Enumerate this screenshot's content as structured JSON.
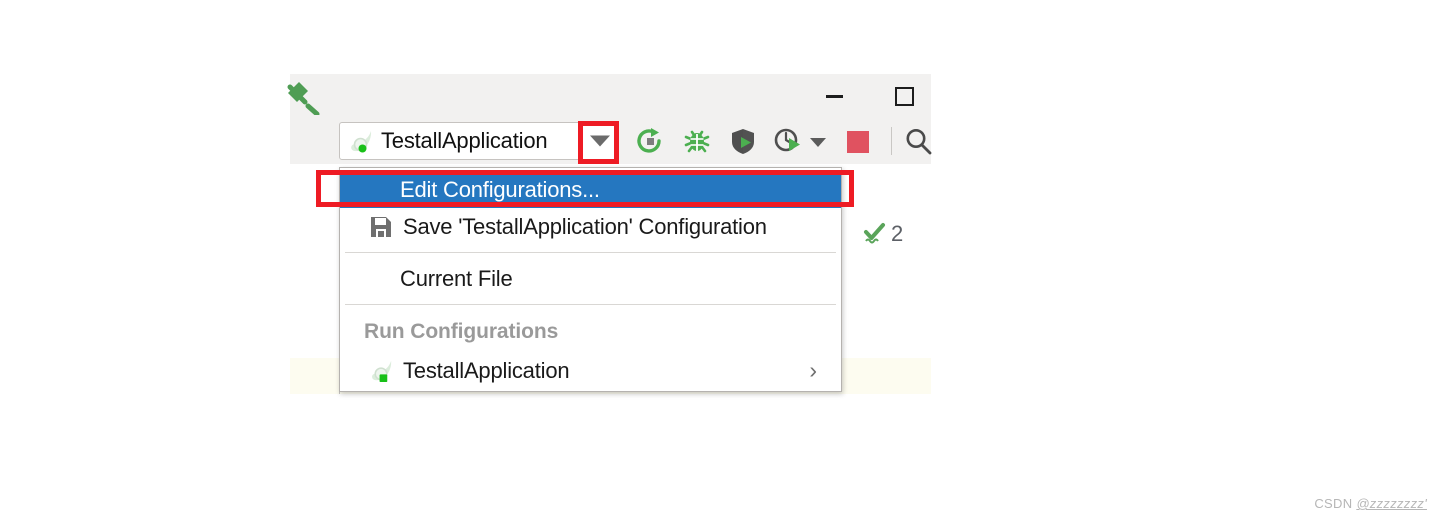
{
  "window": {
    "controls": {
      "minimize": "–",
      "maximize": "□"
    }
  },
  "toolbar": {
    "build_icon": "hammer-build-icon",
    "run_config": {
      "icon": "spring-boot-leaf-icon",
      "label": "TestallApplication",
      "dropdown_icon": "chevron-down-icon"
    },
    "actions": [
      {
        "name": "rerun",
        "icon": "rerun-icon",
        "color": "#4caf50"
      },
      {
        "name": "debug",
        "icon": "debug-bug-icon",
        "color": "#4caf50"
      },
      {
        "name": "run-with-coverage",
        "icon": "coverage-run-icon",
        "color": "#4caf50"
      },
      {
        "name": "profile",
        "icon": "profiler-run-icon",
        "color": "#4caf50"
      },
      {
        "name": "profile-dropdown",
        "icon": "chevron-down-icon",
        "color": "#5b5b5b"
      },
      {
        "name": "stop",
        "icon": "stop-square-icon",
        "color": "#e05260"
      },
      {
        "name": "search-everywhere",
        "icon": "search-icon",
        "color": "#5b5b5b"
      }
    ]
  },
  "editor": {
    "inspections": {
      "icon": "inspection-check-icon",
      "count": "2"
    }
  },
  "menu": {
    "items": [
      {
        "id": "edit-configurations",
        "label": "Edit Configurations...",
        "selected": true,
        "icon": null
      },
      {
        "id": "save-configuration",
        "label": "Save 'TestallApplication' Configuration",
        "selected": false,
        "icon": "save-floppy-icon"
      },
      {
        "id": "current-file",
        "label": "Current File",
        "selected": false,
        "icon": null
      }
    ],
    "section_header": "Run Configurations",
    "configurations": [
      {
        "id": "testall-application",
        "label": "TestallApplication",
        "icon": "spring-boot-leaf-icon",
        "chevron": "›"
      }
    ]
  },
  "annotations": {
    "color": "#ee1b24",
    "boxes": [
      {
        "name": "run-config-dropdown-highlight"
      },
      {
        "name": "edit-configurations-highlight"
      }
    ]
  },
  "watermark": {
    "prefix": "CSDN ",
    "handle": "@zzzzzzzz'"
  }
}
